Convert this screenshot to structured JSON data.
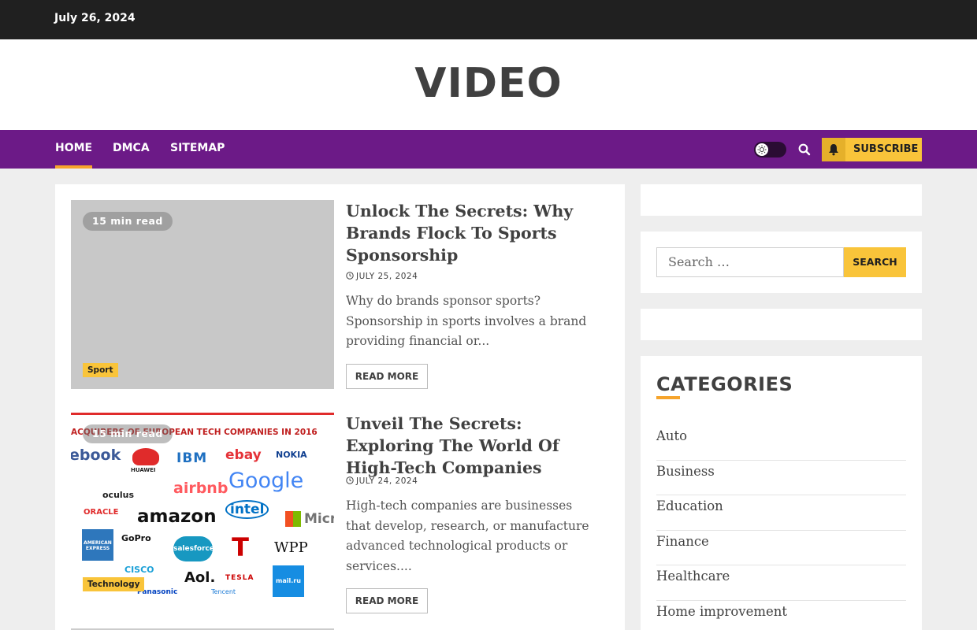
{
  "topbar": {
    "date": "July 26, 2024"
  },
  "site": {
    "title": "VIDEO"
  },
  "nav": {
    "items": [
      {
        "label": "HOME",
        "active": true
      },
      {
        "label": "DMCA",
        "active": false
      },
      {
        "label": "SITEMAP",
        "active": false
      }
    ],
    "subscribe_label": "SUBSCRIBE",
    "icons": [
      "theme-toggle-icon",
      "search-icon",
      "bell-icon"
    ]
  },
  "colors": {
    "nav_bg": "#6c1a87",
    "accent_yellow": "#f9c43a",
    "accent_orange": "#f6a42c",
    "topbar_bg": "#202020"
  },
  "posts": [
    {
      "read_time": "15 min read",
      "category": "Sport",
      "title": "Unlock The Secrets: Why Brands Flock To Sports Sponsorship",
      "date": "JULY 25, 2024",
      "excerpt": "Why do brands sponsor sports? Sponsorship in sports involves a brand providing financial or...",
      "read_more": "READ MORE"
    },
    {
      "read_time": "15 min read",
      "category": "Technology",
      "title": "Unveil The Secrets: Exploring The World Of High-Tech Companies",
      "date": "JULY 24, 2024",
      "excerpt": "High-tech companies are businesses that develop, research, or manufacture advanced technological products or services....",
      "read_more": "READ MORE",
      "image": {
        "heading": "ACQUIRERS OF EUROPEAN TECH COMPANIES IN 2016",
        "logos": [
          "ebook",
          "HUAWEI",
          "IBM",
          "ebay",
          "NOKIA",
          "oculus",
          "airbnb",
          "Google",
          "ORACLE",
          "amazon",
          "intel",
          "Micr",
          "AMERICAN EXPRESS",
          "GoPro",
          "salesforce",
          "WPP",
          "CISCO",
          "Aol.",
          "TESLA",
          "mail.ru",
          "Panasonic",
          "Tencent"
        ]
      }
    }
  ],
  "sidebar": {
    "search_placeholder": "Search …",
    "search_button": "SEARCH",
    "categories_heading": "CATEGORIES",
    "categories": [
      "Auto",
      "Business",
      "Education",
      "Finance",
      "Healthcare",
      "Home improvement"
    ]
  }
}
